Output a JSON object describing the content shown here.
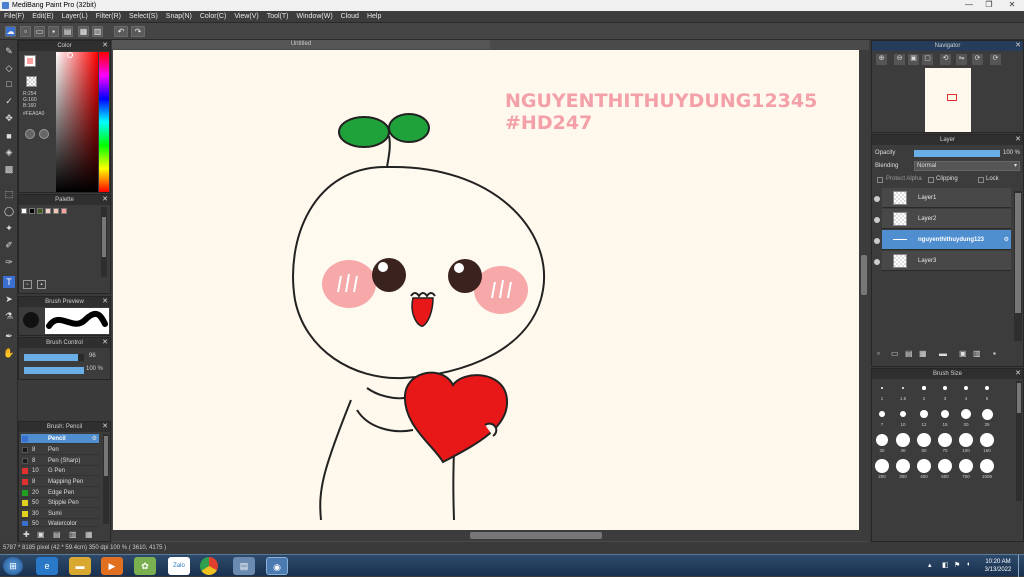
{
  "window": {
    "title": "MediBang Paint Pro (32bit)"
  },
  "menu": [
    "File(F)",
    "Edit(E)",
    "Layer(L)",
    "Filter(R)",
    "Select(S)",
    "Snap(N)",
    "Color(C)",
    "View(V)",
    "Tool(T)",
    "Window(W)",
    "Cloud",
    "Help"
  ],
  "document": {
    "tab_title": "Untitled"
  },
  "artwork": {
    "line1": "NGUYENTHITHUYDUNG12345",
    "line2": "#HD247",
    "text_color": "#f4a0a8"
  },
  "panels": {
    "color": {
      "title": "Color",
      "r": "R:254",
      "g": "G:160",
      "b": "B:160",
      "hex": "#FEA0A0",
      "current": "#fea0a0"
    },
    "palette": {
      "title": "Palette",
      "swatches": [
        "#ffffff",
        "#000000",
        "#3c5a1e",
        "#f5d2c8",
        "#f0c8b4",
        "#fea0a0"
      ]
    },
    "brush_preview": {
      "title": "Brush Preview"
    },
    "brush_control": {
      "title": "Brush Control",
      "size": "96",
      "opacity": "100 %",
      "size_level": 0.9,
      "opacity_level": 1.0
    },
    "brush_list": {
      "title": "Brush: Pencil",
      "items": [
        {
          "size": "",
          "name": "Pencil",
          "color": "#3a6fd0"
        },
        {
          "size": "8",
          "name": "Pen",
          "color": "#1a1a1a"
        },
        {
          "size": "8",
          "name": "Pen (Sharp)",
          "color": "#1a1a1a"
        },
        {
          "size": "10",
          "name": "G Pen",
          "color": "#e03030"
        },
        {
          "size": "8",
          "name": "Mapping Pen",
          "color": "#e03030"
        },
        {
          "size": "20",
          "name": "Edge Pen",
          "color": "#20a020"
        },
        {
          "size": "50",
          "name": "Stipple Pen",
          "color": "#e0d020"
        },
        {
          "size": "30",
          "name": "Sumi",
          "color": "#e0d020"
        },
        {
          "size": "50",
          "name": "Watercolor",
          "color": "#3a6fd0"
        }
      ]
    },
    "navigator": {
      "title": "Navigator"
    },
    "layer": {
      "title": "Layer",
      "opacity_label": "Opacity",
      "opacity_value": "100 %",
      "opacity_level": 1.0,
      "blending_label": "Blending",
      "blending_value": "Normal",
      "protect_alpha": "Protect Alpha",
      "clipping": "Clipping",
      "lock": "Lock",
      "layers": [
        "Layer1",
        "Layer2",
        "nguyenthithuydung123",
        "Layer3"
      ]
    },
    "brush_size": {
      "title": "Brush Size",
      "sizes": [
        "1",
        "1.5",
        "2",
        "3",
        "4",
        "5",
        "7",
        "10",
        "12",
        "15",
        "20",
        "25",
        "30",
        "40",
        "50",
        "70",
        "100",
        "150",
        "200",
        "300",
        "400",
        "500",
        "700",
        "1000"
      ]
    }
  },
  "status": {
    "text": "5787 * 8185 pixel  (42 * 59.4cm)  350 dpi  100 %  ( 3610, 4175 )"
  },
  "taskbar": {
    "time": "10:20 AM",
    "date": "3/13/2022",
    "apps": [
      "start",
      "ie",
      "explorer",
      "media",
      "paint",
      "zalo",
      "chrome",
      "files",
      "medibang"
    ]
  }
}
